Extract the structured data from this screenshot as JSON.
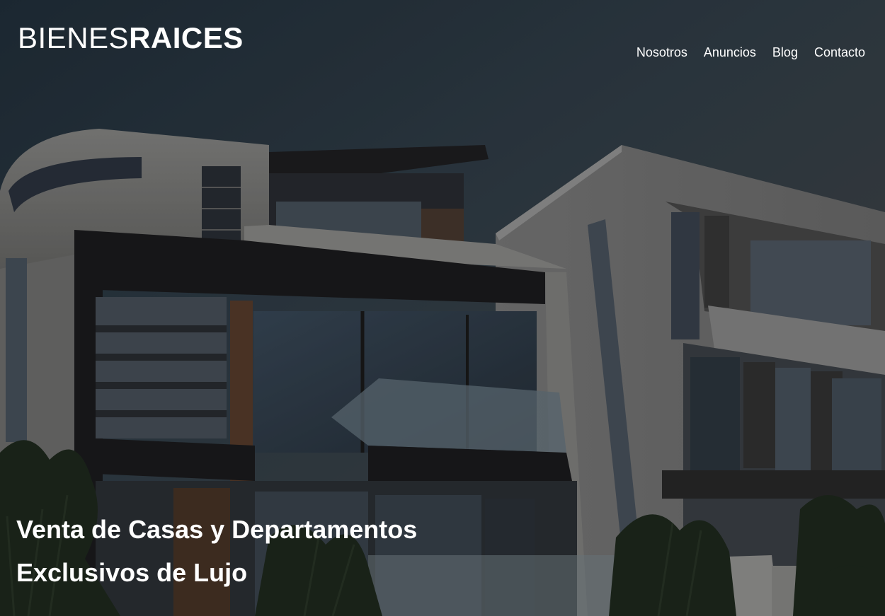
{
  "header": {
    "logo": {
      "light": "BIENES",
      "bold": "RAICES"
    },
    "nav": [
      {
        "label": "Nosotros"
      },
      {
        "label": "Anuncios"
      },
      {
        "label": "Blog"
      },
      {
        "label": "Contacto"
      }
    ]
  },
  "hero": {
    "headline_line1": "Venta de Casas y Departamentos",
    "headline_line2": "Exclusivos de Lujo",
    "background": "modern-house-photo"
  },
  "colors": {
    "text": "#ffffff",
    "sky": "#243340",
    "overlay": "#000000"
  }
}
